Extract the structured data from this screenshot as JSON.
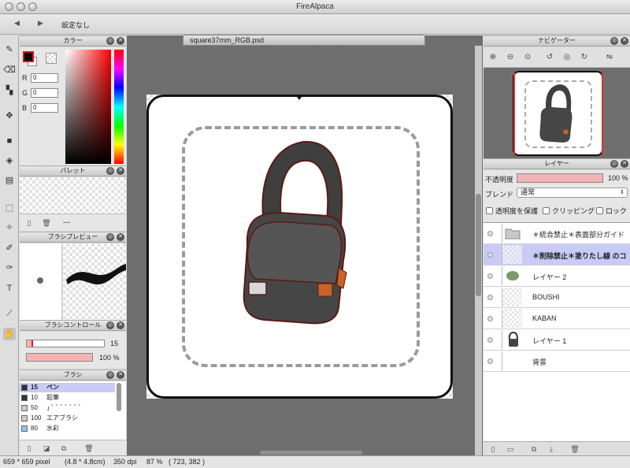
{
  "window": {
    "title": "FireAlpaca"
  },
  "toolbar": {
    "prev_icon": "◀",
    "next_icon": "▶",
    "setting_label": "設定なし"
  },
  "tools": [
    {
      "name": "pen-tool-icon",
      "glyph": "✎"
    },
    {
      "name": "eraser-tool-icon",
      "glyph": "⌫"
    },
    {
      "name": "dot-tool-icon",
      "glyph": "▚"
    },
    {
      "name": "move-tool-icon",
      "glyph": "✥"
    },
    {
      "name": "fill-rect-tool-icon",
      "glyph": "■"
    },
    {
      "name": "bucket-tool-icon",
      "glyph": "◈"
    },
    {
      "name": "gradient-tool-icon",
      "glyph": "▤"
    },
    {
      "name": "select-tool-icon",
      "glyph": "⬚"
    },
    {
      "name": "magic-wand-tool-icon",
      "glyph": "✧"
    },
    {
      "name": "select-pen-tool-icon",
      "glyph": "✐"
    },
    {
      "name": "select-eraser-tool-icon",
      "glyph": "✑"
    },
    {
      "name": "text-tool-icon",
      "glyph": "T"
    },
    {
      "name": "eyedropper-tool-icon",
      "glyph": "⟋"
    },
    {
      "name": "hand-tool-icon",
      "glyph": "✋"
    }
  ],
  "color_panel": {
    "title": "カラー",
    "r_label": "R",
    "g_label": "G",
    "b_label": "B",
    "r": "0",
    "g": "0",
    "b": "0"
  },
  "palette_panel": {
    "title": "パレット",
    "dashes": "---"
  },
  "brush_preview_panel": {
    "title": "ブラシプレビュー"
  },
  "brush_control_panel": {
    "title": "ブラシコントロール",
    "size": "15",
    "opacity": "100 %",
    "size_fraction": 0.08,
    "opacity_fraction": 1.0
  },
  "brush_panel": {
    "title": "ブラシ",
    "items": [
      {
        "size": "15",
        "name": "ペン",
        "swatch": "#333333",
        "selected": true
      },
      {
        "size": "10",
        "name": "鉛筆",
        "swatch": "#333333",
        "selected": false
      },
      {
        "size": "50",
        "name": "｣ ﾞ ﾞ ﾞ ﾞ ﾞ ﾞ ﾞ",
        "swatch": "#cccccc",
        "selected": false
      },
      {
        "size": "100",
        "name": "エアブラシ",
        "swatch": "#cccccc",
        "selected": false
      },
      {
        "size": "80",
        "name": "水彩",
        "swatch": "#88c8ff",
        "selected": false
      }
    ]
  },
  "document": {
    "tab_title": "square37mm_RGB.psd"
  },
  "navigator_panel": {
    "title": "ナビゲーター"
  },
  "layer_panel": {
    "title": "レイヤー",
    "opacity_label": "不透明度",
    "opacity_value": "100 %",
    "blend_label": "ブレンド",
    "blend_value": "通常",
    "protect_alpha": "透明度を保護",
    "clipping": "クリッピング",
    "lock": "ロック",
    "layers": [
      {
        "name": "＊統合禁止＊表面部分ガイド",
        "selected": false,
        "thumb": "folder"
      },
      {
        "name": "＊削除禁止＊塗りたし線 のコ",
        "selected": true,
        "thumb": "empty"
      },
      {
        "name": "レイヤー 2",
        "selected": false,
        "thumb": "hat"
      },
      {
        "name": "BOUSHI",
        "selected": false,
        "thumb": "text"
      },
      {
        "name": "KABAN",
        "selected": false,
        "thumb": "text"
      },
      {
        "name": "レイヤー 1",
        "selected": false,
        "thumb": "bag"
      },
      {
        "name": "背景",
        "selected": false,
        "thumb": "white"
      }
    ]
  },
  "status": {
    "size": "659 * 659 pixel",
    "physical": "(4.8 * 4.8cm)",
    "dpi": "350 dpi",
    "zoom": "87 %",
    "coords": "( 723, 382 )"
  }
}
